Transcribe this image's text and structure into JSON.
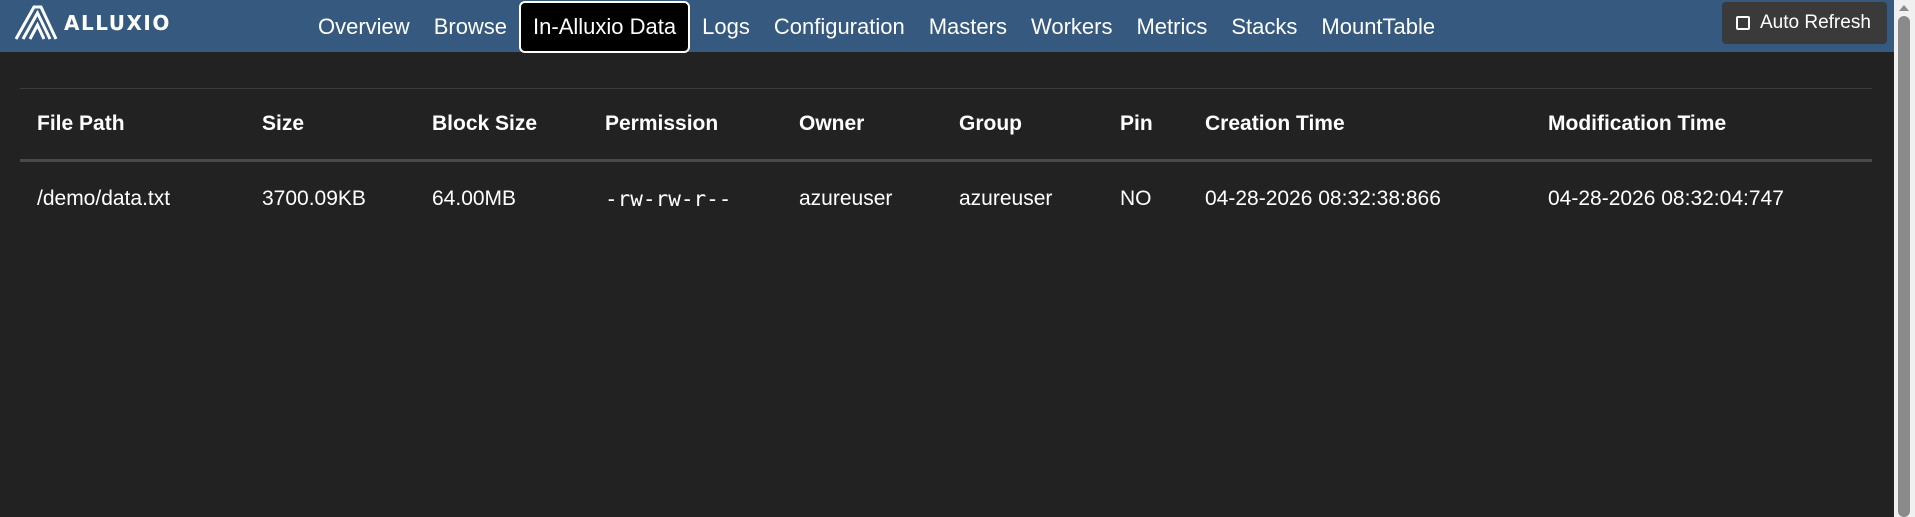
{
  "brand": {
    "name": "ALLUXIO",
    "logo_icon": "alluxio-logo-icon"
  },
  "nav": {
    "items": [
      {
        "label": "Overview",
        "active": false
      },
      {
        "label": "Browse",
        "active": false
      },
      {
        "label": "In-Alluxio Data",
        "active": true
      },
      {
        "label": "Logs",
        "active": false
      },
      {
        "label": "Configuration",
        "active": false
      },
      {
        "label": "Masters",
        "active": false
      },
      {
        "label": "Workers",
        "active": false
      },
      {
        "label": "Metrics",
        "active": false
      },
      {
        "label": "Stacks",
        "active": false
      },
      {
        "label": "MountTable",
        "active": false
      }
    ]
  },
  "auto_refresh": {
    "label": "Auto Refresh",
    "checked": false
  },
  "table": {
    "headers": [
      "File Path",
      "Size",
      "Block Size",
      "Permission",
      "Owner",
      "Group",
      "Pin",
      "Creation Time",
      "Modification Time"
    ],
    "rows": [
      [
        "/demo/data.txt",
        "3700.09KB",
        "64.00MB",
        "-rw-rw-r--",
        "azureuser",
        "azureuser",
        "NO",
        "04-28-2026 08:32:38:866",
        "04-28-2026 08:32:04:747"
      ]
    ]
  },
  "colors": {
    "navbar": "#35597f",
    "background": "#222222",
    "active_tab_bg": "#000000",
    "text": "#ffffff"
  }
}
